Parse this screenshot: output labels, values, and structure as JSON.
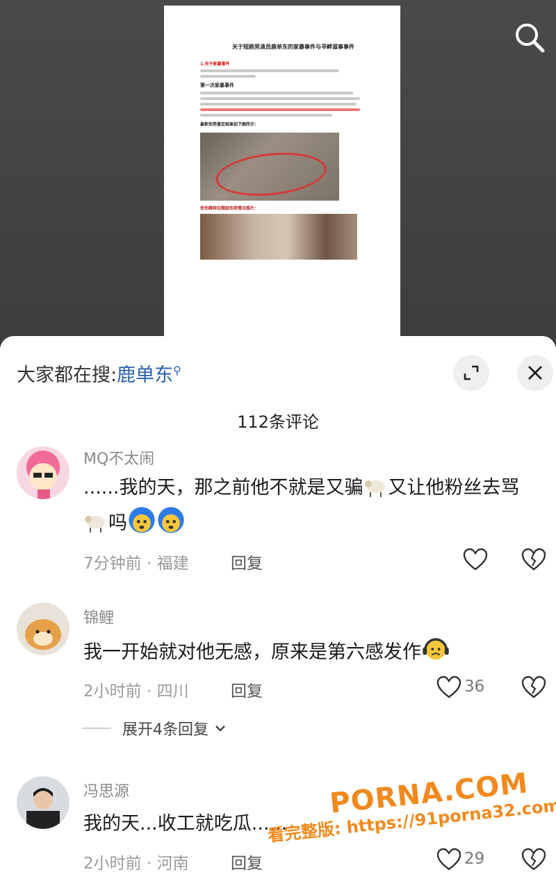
{
  "document": {
    "title": "关于短剧男演员鹿单东的家暴事件与寻衅滋事事件",
    "section1": "1.关于家暴事件",
    "sub1": "第一次家暴事件",
    "photo_caption1": "最新伤势鉴定结果如下图所示：",
    "photo_caption2": "受伤精神及精部伤势情况照片："
  },
  "search_suggest": {
    "prefix": "大家都在搜:",
    "keyword": "鹿单东"
  },
  "icons": {
    "top_search": "search-icon",
    "expand": "expand-icon",
    "close": "close-icon",
    "like": "heart-icon",
    "dislike": "broken-heart-icon"
  },
  "comments_header": {
    "count_text": "112条评论"
  },
  "comments": [
    {
      "name": "MQ不太闹",
      "text_parts": [
        "......我的天，那之前他不就是又骗",
        "又让他粉丝去骂",
        "吗"
      ],
      "time": "7分钟前",
      "location": "福建",
      "reply_label": "回复",
      "likes": ""
    },
    {
      "name": "锦鲤",
      "text": "我一开始就对他无感，原来是第六感发作",
      "time": "2小时前",
      "location": "四川",
      "reply_label": "回复",
      "likes": "36"
    },
    {
      "name": "冯思源",
      "text": "我的天...收工就吃瓜......",
      "time": "2小时前",
      "location": "河南",
      "reply_label": "回复",
      "likes": "29"
    }
  ],
  "expand_replies": {
    "label": "展开4条回复"
  },
  "watermark": {
    "brand": "PORNA.COM",
    "line2": "看完整版: https://91porna32.com"
  },
  "colors": {
    "link_blue": "#2a5fad",
    "watermark_orange": "#f08a1e",
    "annotation_red": "#d63a3a"
  }
}
